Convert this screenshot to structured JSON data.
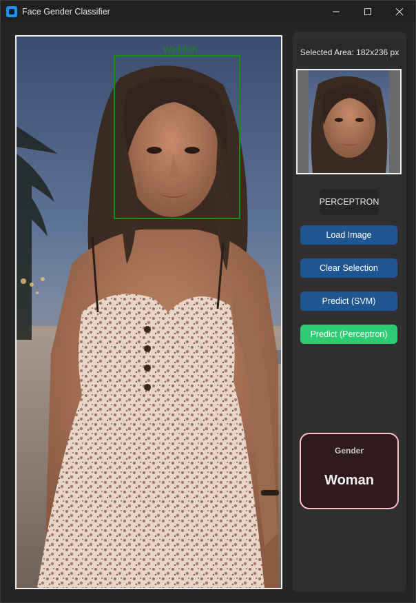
{
  "window": {
    "title": "Face Gender Classifier",
    "minimize": "—",
    "maximize": "☐",
    "close": "✕"
  },
  "image": {
    "selection_label": "Weiblich"
  },
  "sidebar": {
    "selected_area": "Selected Area: 182x236 px",
    "model": "PERCEPTRON",
    "buttons": {
      "load": "Load Image",
      "clear": "Clear Selection",
      "predict_svm": "Predict (SVM)",
      "predict_perceptron": "Predict (Perceptron)"
    },
    "result": {
      "label": "Gender",
      "value": "Woman"
    }
  },
  "colors": {
    "accent_blue": "#1f5591",
    "accent_green": "#2ecc71",
    "selection_green": "#1a8a1a",
    "result_border": "#ffc0cb"
  }
}
